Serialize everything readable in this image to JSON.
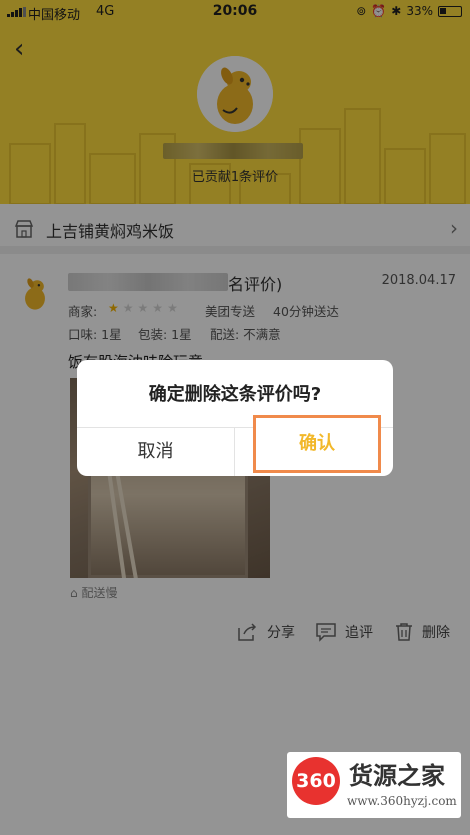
{
  "status_bar": {
    "carrier": "中国移动",
    "network": "4G",
    "time": "20:06",
    "battery": "33%"
  },
  "header": {
    "contribution": "已贡献1条评价"
  },
  "shop": {
    "name": "上吉铺黄焖鸡米饭"
  },
  "review": {
    "name_suffix": "名评价)",
    "date": "2018.04.17",
    "merchant_label": "商家:",
    "rating_stars": 1,
    "rating_max": 5,
    "delivery_by": "美团专送",
    "delivery_time": "40分钟送达",
    "taste": "口味: 1星",
    "packaging": "包装: 1星",
    "delivery": "配送: 不满意",
    "text": "饭有股海油味险玩意",
    "tag": "配送慢",
    "actions": {
      "share": "分享",
      "follow_up": "追评",
      "delete": "删除"
    }
  },
  "dialog": {
    "title": "确定删除这条评价吗?",
    "cancel": "取消",
    "confirm": "确认"
  },
  "watermark": {
    "logo": "360",
    "title": "货源之家",
    "url": "www.360hyzj.com"
  },
  "colors": {
    "header_yellow": "#ffdc3e",
    "highlight_orange": "#f08a4b",
    "confirm_text": "#f2b82a",
    "star_on": "#f5b400",
    "logo_red": "#e8322f"
  }
}
